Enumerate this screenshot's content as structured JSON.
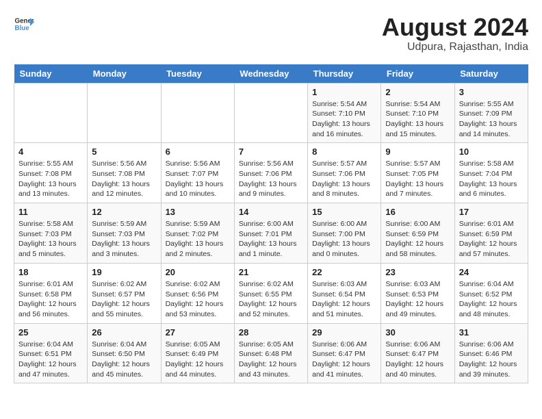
{
  "header": {
    "logo_general": "General",
    "logo_blue": "Blue",
    "month": "August 2024",
    "location": "Udpura, Rajasthan, India"
  },
  "days_of_week": [
    "Sunday",
    "Monday",
    "Tuesday",
    "Wednesday",
    "Thursday",
    "Friday",
    "Saturday"
  ],
  "weeks": [
    [
      {
        "day": "",
        "info": ""
      },
      {
        "day": "",
        "info": ""
      },
      {
        "day": "",
        "info": ""
      },
      {
        "day": "",
        "info": ""
      },
      {
        "day": "1",
        "info": "Sunrise: 5:54 AM\nSunset: 7:10 PM\nDaylight: 13 hours\nand 16 minutes."
      },
      {
        "day": "2",
        "info": "Sunrise: 5:54 AM\nSunset: 7:10 PM\nDaylight: 13 hours\nand 15 minutes."
      },
      {
        "day": "3",
        "info": "Sunrise: 5:55 AM\nSunset: 7:09 PM\nDaylight: 13 hours\nand 14 minutes."
      }
    ],
    [
      {
        "day": "4",
        "info": "Sunrise: 5:55 AM\nSunset: 7:08 PM\nDaylight: 13 hours\nand 13 minutes."
      },
      {
        "day": "5",
        "info": "Sunrise: 5:56 AM\nSunset: 7:08 PM\nDaylight: 13 hours\nand 12 minutes."
      },
      {
        "day": "6",
        "info": "Sunrise: 5:56 AM\nSunset: 7:07 PM\nDaylight: 13 hours\nand 10 minutes."
      },
      {
        "day": "7",
        "info": "Sunrise: 5:56 AM\nSunset: 7:06 PM\nDaylight: 13 hours\nand 9 minutes."
      },
      {
        "day": "8",
        "info": "Sunrise: 5:57 AM\nSunset: 7:06 PM\nDaylight: 13 hours\nand 8 minutes."
      },
      {
        "day": "9",
        "info": "Sunrise: 5:57 AM\nSunset: 7:05 PM\nDaylight: 13 hours\nand 7 minutes."
      },
      {
        "day": "10",
        "info": "Sunrise: 5:58 AM\nSunset: 7:04 PM\nDaylight: 13 hours\nand 6 minutes."
      }
    ],
    [
      {
        "day": "11",
        "info": "Sunrise: 5:58 AM\nSunset: 7:03 PM\nDaylight: 13 hours\nand 5 minutes."
      },
      {
        "day": "12",
        "info": "Sunrise: 5:59 AM\nSunset: 7:03 PM\nDaylight: 13 hours\nand 3 minutes."
      },
      {
        "day": "13",
        "info": "Sunrise: 5:59 AM\nSunset: 7:02 PM\nDaylight: 13 hours\nand 2 minutes."
      },
      {
        "day": "14",
        "info": "Sunrise: 6:00 AM\nSunset: 7:01 PM\nDaylight: 13 hours\nand 1 minute."
      },
      {
        "day": "15",
        "info": "Sunrise: 6:00 AM\nSunset: 7:00 PM\nDaylight: 13 hours\nand 0 minutes."
      },
      {
        "day": "16",
        "info": "Sunrise: 6:00 AM\nSunset: 6:59 PM\nDaylight: 12 hours\nand 58 minutes."
      },
      {
        "day": "17",
        "info": "Sunrise: 6:01 AM\nSunset: 6:59 PM\nDaylight: 12 hours\nand 57 minutes."
      }
    ],
    [
      {
        "day": "18",
        "info": "Sunrise: 6:01 AM\nSunset: 6:58 PM\nDaylight: 12 hours\nand 56 minutes."
      },
      {
        "day": "19",
        "info": "Sunrise: 6:02 AM\nSunset: 6:57 PM\nDaylight: 12 hours\nand 55 minutes."
      },
      {
        "day": "20",
        "info": "Sunrise: 6:02 AM\nSunset: 6:56 PM\nDaylight: 12 hours\nand 53 minutes."
      },
      {
        "day": "21",
        "info": "Sunrise: 6:02 AM\nSunset: 6:55 PM\nDaylight: 12 hours\nand 52 minutes."
      },
      {
        "day": "22",
        "info": "Sunrise: 6:03 AM\nSunset: 6:54 PM\nDaylight: 12 hours\nand 51 minutes."
      },
      {
        "day": "23",
        "info": "Sunrise: 6:03 AM\nSunset: 6:53 PM\nDaylight: 12 hours\nand 49 minutes."
      },
      {
        "day": "24",
        "info": "Sunrise: 6:04 AM\nSunset: 6:52 PM\nDaylight: 12 hours\nand 48 minutes."
      }
    ],
    [
      {
        "day": "25",
        "info": "Sunrise: 6:04 AM\nSunset: 6:51 PM\nDaylight: 12 hours\nand 47 minutes."
      },
      {
        "day": "26",
        "info": "Sunrise: 6:04 AM\nSunset: 6:50 PM\nDaylight: 12 hours\nand 45 minutes."
      },
      {
        "day": "27",
        "info": "Sunrise: 6:05 AM\nSunset: 6:49 PM\nDaylight: 12 hours\nand 44 minutes."
      },
      {
        "day": "28",
        "info": "Sunrise: 6:05 AM\nSunset: 6:48 PM\nDaylight: 12 hours\nand 43 minutes."
      },
      {
        "day": "29",
        "info": "Sunrise: 6:06 AM\nSunset: 6:47 PM\nDaylight: 12 hours\nand 41 minutes."
      },
      {
        "day": "30",
        "info": "Sunrise: 6:06 AM\nSunset: 6:47 PM\nDaylight: 12 hours\nand 40 minutes."
      },
      {
        "day": "31",
        "info": "Sunrise: 6:06 AM\nSunset: 6:46 PM\nDaylight: 12 hours\nand 39 minutes."
      }
    ]
  ]
}
